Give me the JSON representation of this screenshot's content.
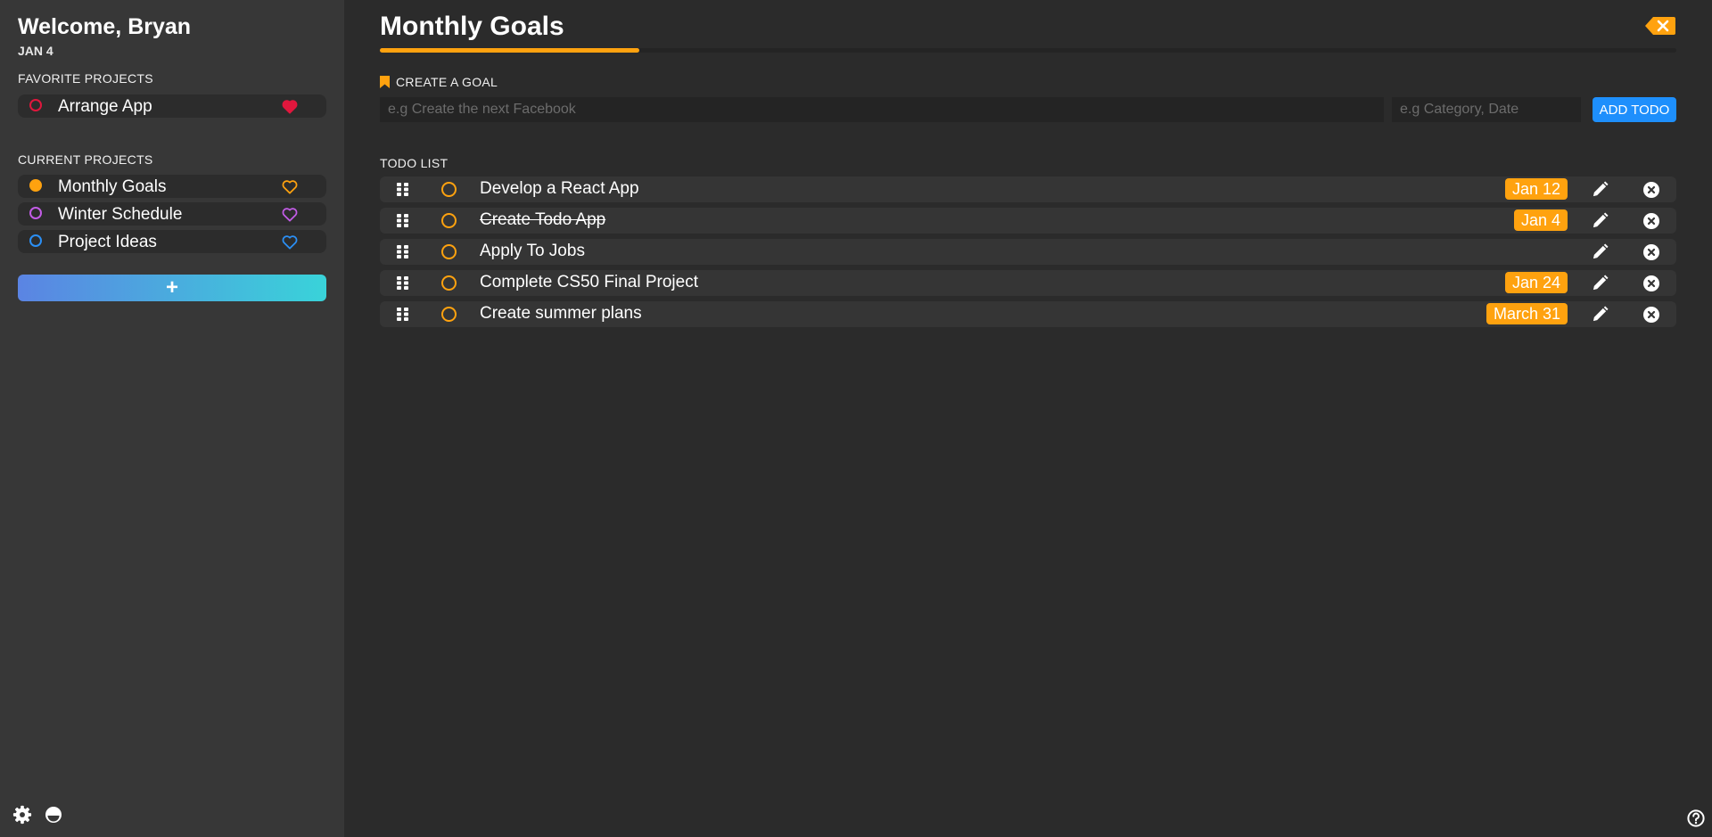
{
  "sidebar": {
    "welcome": "Welcome, Bryan",
    "date": "JAN 4",
    "favorites_title": "FAVORITE PROJECTS",
    "favorites": [
      {
        "label": "Arrange App",
        "color": "#e0173d",
        "dot": "outline",
        "heart": "filled"
      }
    ],
    "current_title": "CURRENT PROJECTS",
    "current": [
      {
        "label": "Monthly Goals",
        "color": "#ffa20f",
        "dot": "filled",
        "heart": "outline"
      },
      {
        "label": "Winter Schedule",
        "color": "#c25ce6",
        "dot": "outline",
        "heart": "outline"
      },
      {
        "label": "Project Ideas",
        "color": "#2b8ff5",
        "dot": "outline",
        "heart": "outline"
      }
    ],
    "add_button": "+",
    "icons": [
      "gear-icon",
      "theme-toggle-icon"
    ]
  },
  "main": {
    "title": "Monthly Goals",
    "progress": 0.2,
    "accent": "#ffa20f",
    "create_label": "CREATE A GOAL",
    "goal_placeholder": "e.g Create the next Facebook",
    "meta_placeholder": "e.g Category, Date",
    "add_button": "ADD TODO",
    "add_button_color": "#1e8ffc",
    "todo_label": "TODO LIST",
    "todos": [
      {
        "text": "Develop a React App",
        "due": "Jan 12",
        "done": false
      },
      {
        "text": "Create Todo App",
        "due": "Jan 4",
        "done": true
      },
      {
        "text": "Apply To Jobs",
        "due": "",
        "done": false
      },
      {
        "text": "Complete CS50 Final Project",
        "due": "Jan 24",
        "done": false
      },
      {
        "text": "Create summer plans",
        "due": "March 31",
        "done": false
      }
    ],
    "icons": [
      "close-tag-icon",
      "bookmark-icon",
      "drag-handle-icon",
      "pencil-icon",
      "delete-icon",
      "help-icon"
    ]
  }
}
